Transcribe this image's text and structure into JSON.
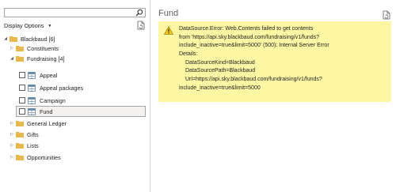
{
  "navigator": {
    "search_value": "",
    "display_options_label": "Display Options",
    "tree": [
      {
        "label": "Blackbaud [6]",
        "kind": "folder",
        "expanded": true,
        "level": 0
      },
      {
        "label": "Constituents",
        "kind": "folder",
        "expanded": false,
        "level": 1
      },
      {
        "label": "Fundraising [4]",
        "kind": "folder",
        "expanded": true,
        "level": 1
      },
      {
        "label": "Appeal",
        "kind": "table",
        "checked": false,
        "level": 2
      },
      {
        "label": "Appeal packages",
        "kind": "table",
        "checked": false,
        "level": 2
      },
      {
        "label": "Campaign",
        "kind": "table",
        "checked": false,
        "level": 2
      },
      {
        "label": "Fund",
        "kind": "table",
        "checked": false,
        "level": 2,
        "selected": true
      },
      {
        "label": "General Ledger",
        "kind": "folder",
        "expanded": false,
        "level": 1
      },
      {
        "label": "Gifts",
        "kind": "folder",
        "expanded": false,
        "level": 1
      },
      {
        "label": "Lists",
        "kind": "folder",
        "expanded": false,
        "level": 1
      },
      {
        "label": "Opportunities",
        "kind": "folder",
        "expanded": false,
        "level": 1
      }
    ]
  },
  "preview": {
    "title": "Fund",
    "error_lines": [
      "DataSource.Error: Web.Contents failed to get contents",
      "from 'https://api.sky.blackbaud.com/fundraising/v1/funds?",
      "include_inactive=true&limit=5000' (500): Internal Server Error",
      "Details:",
      "DataSourceKind=Blackbaud",
      "DataSourcePath=Blackbaud",
      "Url=https://api.sky.blackbaud.com/fundraising/v1/funds?",
      "include_inactive=true&limit=5000"
    ]
  },
  "colors": {
    "error_background": "#fdf6a3",
    "folder": "#e8b84a",
    "warning": "#f2c811",
    "selected_row": "#f3f2f1"
  },
  "icons": [
    "search-icon",
    "refresh-icon",
    "folder-icon",
    "table-icon",
    "warning-icon",
    "document-icon",
    "chevron-down-icon",
    "chevron-right-icon"
  ]
}
